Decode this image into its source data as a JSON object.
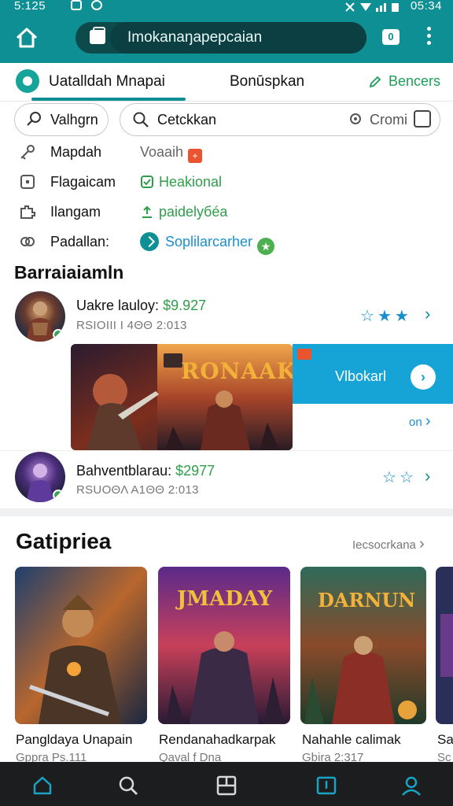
{
  "status_bar": {
    "time_left": "5:125",
    "time_right": "05:34",
    "network": ""
  },
  "browser": {
    "url": "Imokanaŋapepcaian",
    "tab_count": "0"
  },
  "tabs": [
    {
      "label": "Uatalldah Mnapai"
    },
    {
      "label": "Bonūspkan"
    },
    {
      "label": "Bencers"
    }
  ],
  "filter": {
    "chip_label": "Valhgrn",
    "search_value": "Cetckkan",
    "side_label": "Cromi"
  },
  "info_rows": [
    {
      "label": "Mapdah",
      "value": "Voaaih",
      "icon": "key-icon"
    },
    {
      "label": "Flagaicam",
      "value": "Heakional",
      "icon": "square-icon"
    },
    {
      "label": "Ilangam",
      "value": "paidelyбéa",
      "icon": "puzzle-icon"
    },
    {
      "label": "Padallan:",
      "value": "Soplilarcarher",
      "icon": "link-icon"
    }
  ],
  "section": {
    "title": "Barraiaiamln"
  },
  "listings": [
    {
      "title": "Uakre lauloy:",
      "price": "$9.927",
      "meta": "RSIOIII Ι 4ΘΘ 2:013",
      "rating": 3
    },
    {
      "title": "Bahventblarau:",
      "price": "$2977",
      "meta": "RSUOΘΛ Α1ΘΘ 2:013",
      "rating": 2
    }
  ],
  "banner": {
    "game_title": "RONAAK",
    "cta_text": "Vlbokarl",
    "small_link": "on"
  },
  "gallery": {
    "title": "Gatipriea",
    "more_label": "Iecsocrkana",
    "cards": [
      {
        "name": "Pangldaya Unapain",
        "sub": "Gppra Ps.111"
      },
      {
        "name": "Rendanahadkarpak",
        "sub": "Qaval f Dna"
      },
      {
        "name": "Nahahle calimak",
        "sub": "Gbira 2:317"
      },
      {
        "name": "Sa",
        "sub": "Sc"
      }
    ],
    "card_titles": [
      "",
      "JMADAY",
      "DARNUN",
      ""
    ]
  },
  "colors": {
    "brand": "#0e8f93",
    "price": "#2e9e4a",
    "accent_blue": "#16a3d6"
  }
}
